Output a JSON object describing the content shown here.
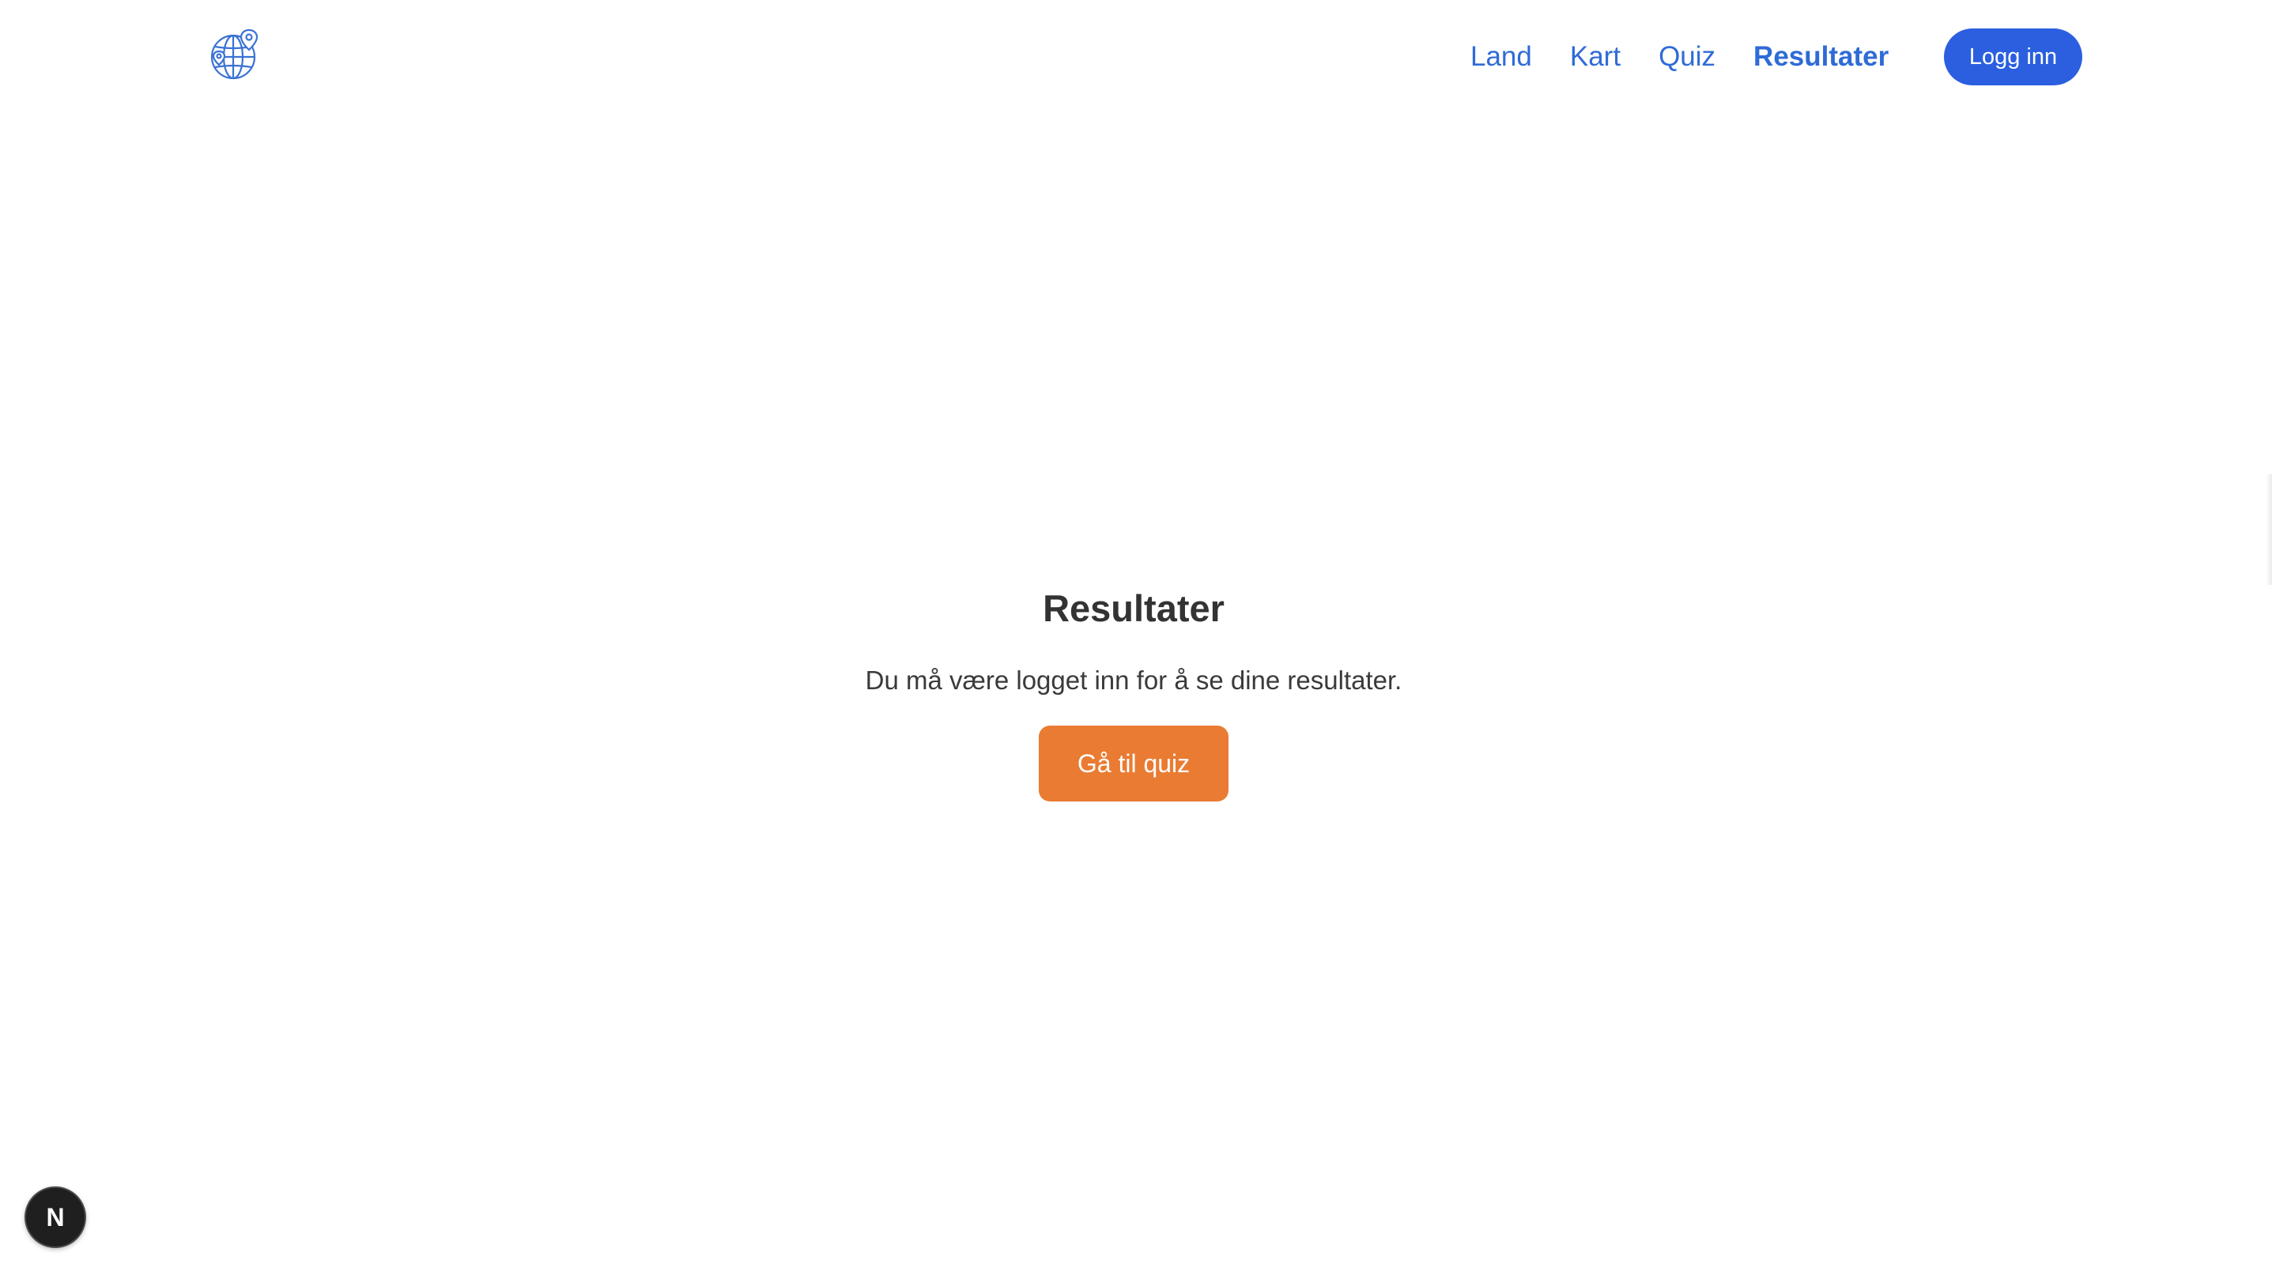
{
  "header": {
    "logo_icon": "globe-with-map-pins-icon",
    "nav": [
      {
        "label": "Land",
        "active": false
      },
      {
        "label": "Kart",
        "active": false
      },
      {
        "label": "Quiz",
        "active": false
      },
      {
        "label": "Resultater",
        "active": true
      }
    ],
    "login_label": "Logg inn"
  },
  "main": {
    "title": "Resultater",
    "message": "Du må være logget inn for å se dine resultater.",
    "quiz_button_label": "Gå til quiz"
  },
  "dev_indicator": {
    "label": "N",
    "icon": "nextjs-dev-indicator-icon"
  },
  "colors": {
    "nav_link": "#2f6bd6",
    "login_button": "#2b5fe0",
    "quiz_button": "#e97b33",
    "heading": "#333333"
  }
}
